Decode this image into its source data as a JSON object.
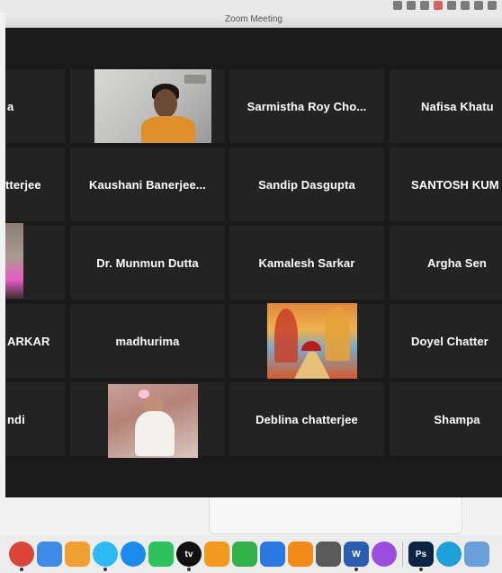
{
  "window": {
    "title": "Zoom Meeting"
  },
  "participants": [
    {
      "name": "a",
      "row": 0,
      "col": 0
    },
    {
      "name": "",
      "row": 0,
      "col": 1,
      "video": "woman-in-orange-sari"
    },
    {
      "name": "Sarmistha Roy Cho...",
      "row": 0,
      "col": 2
    },
    {
      "name": "Nafisa Khatu",
      "row": 0,
      "col": 3
    },
    {
      "name": "tterjee",
      "row": 1,
      "col": 0
    },
    {
      "name": "Kaushani Banerjee...",
      "row": 1,
      "col": 1
    },
    {
      "name": "Sandip Dasgupta",
      "row": 1,
      "col": 2
    },
    {
      "name": "SANTOSH KUM",
      "row": 1,
      "col": 3
    },
    {
      "name": "",
      "row": 2,
      "col": 0,
      "video": "partial-person"
    },
    {
      "name": "Dr. Munmun Dutta",
      "row": 2,
      "col": 1
    },
    {
      "name": "Kamalesh Sarkar",
      "row": 2,
      "col": 2
    },
    {
      "name": "Argha Sen",
      "row": 2,
      "col": 3
    },
    {
      "name": "ARKAR",
      "row": 3,
      "col": 0
    },
    {
      "name": "madhurima",
      "row": 3,
      "col": 1
    },
    {
      "name": "",
      "row": 3,
      "col": 2,
      "video": "painting-autumn-umbrella"
    },
    {
      "name": "Doyel Chatter",
      "row": 3,
      "col": 3
    },
    {
      "name": "ndi",
      "row": 4,
      "col": 0
    },
    {
      "name": "",
      "row": 4,
      "col": 1,
      "video": "little-girl-white-dress"
    },
    {
      "name": "Deblina chatterjee",
      "row": 4,
      "col": 2
    },
    {
      "name": "Shampa",
      "row": 4,
      "col": 3
    }
  ],
  "dock": {
    "apps": [
      {
        "icon": "chrome-icon",
        "color": "#db4437",
        "glyph": ""
      },
      {
        "icon": "finder-icon",
        "color": "#3d8be8",
        "glyph": ""
      },
      {
        "icon": "photos-icon",
        "color": "#f0a030",
        "glyph": ""
      },
      {
        "icon": "messages-icon",
        "color": "#2fb9f2",
        "glyph": ""
      },
      {
        "icon": "app-store-icon",
        "color": "#1a8cf0",
        "glyph": ""
      },
      {
        "icon": "facetime-icon",
        "color": "#2ec25a",
        "glyph": ""
      },
      {
        "icon": "apple-tv-icon",
        "color": "#111111",
        "glyph": "tv"
      },
      {
        "icon": "pages-icon",
        "color": "#f39a1d",
        "glyph": ""
      },
      {
        "icon": "numbers-icon",
        "color": "#33b24a",
        "glyph": ""
      },
      {
        "icon": "keynote-icon",
        "color": "#2b78e4",
        "glyph": ""
      },
      {
        "icon": "books-icon",
        "color": "#f28a1a",
        "glyph": ""
      },
      {
        "icon": "screenshot-icon",
        "color": "#5a5a5a",
        "glyph": ""
      },
      {
        "icon": "word-icon",
        "color": "#2a5db0",
        "glyph": "W"
      },
      {
        "icon": "podcasts-icon",
        "color": "#9b4de0",
        "glyph": ""
      },
      {
        "icon": "photoshop-icon",
        "color": "#0b2444",
        "glyph": "Ps"
      },
      {
        "icon": "circle-app-icon",
        "color": "#1fa0d8",
        "glyph": ""
      },
      {
        "icon": "trash-icon",
        "color": "#6aa0d8",
        "glyph": ""
      }
    ]
  }
}
